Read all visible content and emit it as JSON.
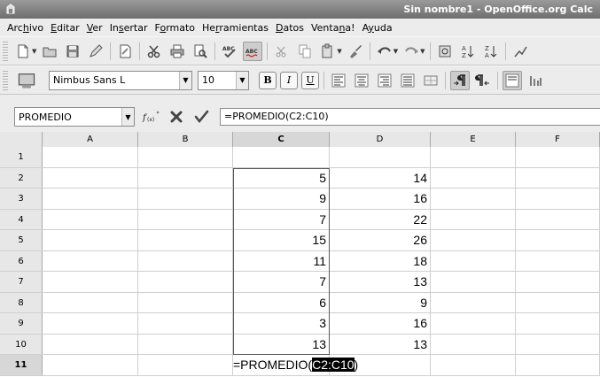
{
  "window": {
    "title": "Sin nombre1 - OpenOffice.org Calc"
  },
  "menu": [
    {
      "pre": "Arc",
      "u": "h",
      "post": "ivo"
    },
    {
      "pre": "",
      "u": "E",
      "post": "ditar"
    },
    {
      "pre": "",
      "u": "V",
      "post": "er"
    },
    {
      "pre": "In",
      "u": "s",
      "post": "ertar"
    },
    {
      "pre": "F",
      "u": "o",
      "post": "rmato"
    },
    {
      "pre": "He",
      "u": "r",
      "post": "ramientas"
    },
    {
      "pre": "",
      "u": "D",
      "post": "atos"
    },
    {
      "pre": "Venta",
      "u": "n",
      "post": "a!"
    },
    {
      "pre": "A",
      "u": "y",
      "post": "uda"
    }
  ],
  "format_toolbar": {
    "font_name": "Nimbus Sans L",
    "font_size": "10",
    "bold": "B",
    "italic": "I",
    "underline": "U"
  },
  "formula_bar": {
    "name_box": "PROMEDIO",
    "formula": "=PROMEDIO(C2:C10)"
  },
  "sheet": {
    "columns": [
      "A",
      "B",
      "C",
      "D",
      "E",
      "F"
    ],
    "active_column": "C",
    "active_row": "11",
    "rows": [
      {
        "n": "1",
        "c": "",
        "d": ""
      },
      {
        "n": "2",
        "c": "5",
        "d": "14"
      },
      {
        "n": "3",
        "c": "9",
        "d": "16"
      },
      {
        "n": "4",
        "c": "7",
        "d": "22"
      },
      {
        "n": "5",
        "c": "15",
        "d": "26"
      },
      {
        "n": "6",
        "c": "11",
        "d": "18"
      },
      {
        "n": "7",
        "c": "7",
        "d": "13"
      },
      {
        "n": "8",
        "c": "6",
        "d": "9"
      },
      {
        "n": "9",
        "c": "3",
        "d": "16"
      },
      {
        "n": "10",
        "c": "13",
        "d": "13"
      },
      {
        "n": "11",
        "c": "",
        "d": ""
      }
    ],
    "edit_cell": {
      "prefix": "=PROMEDIO(",
      "selected": "C2:C10",
      "suffix": ")"
    }
  }
}
